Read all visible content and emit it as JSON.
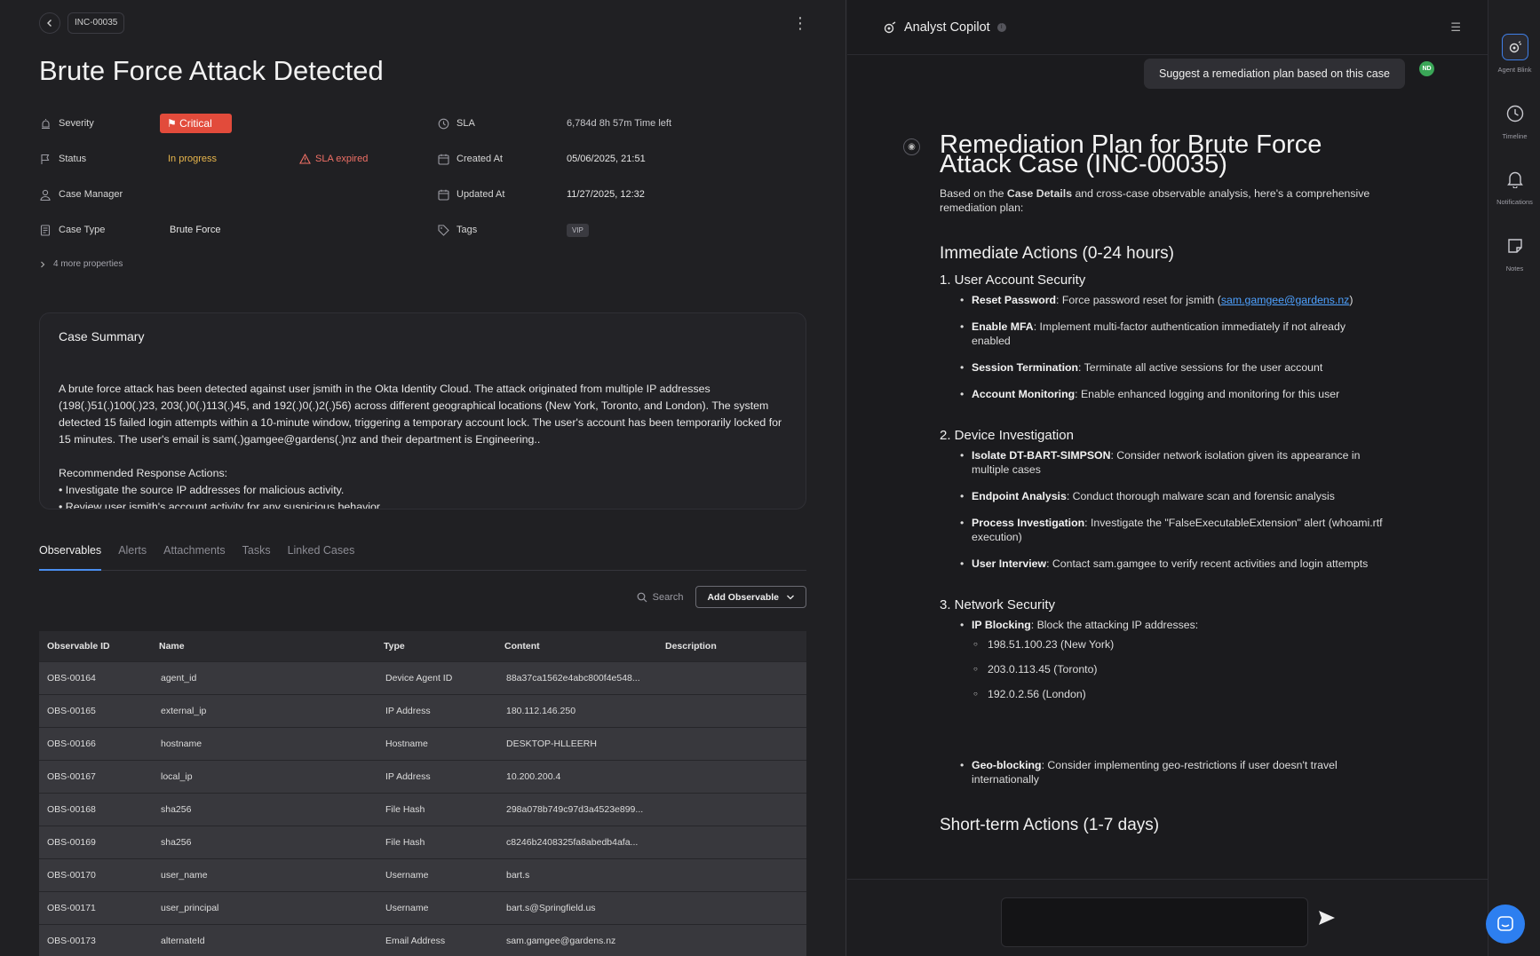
{
  "header": {
    "case_id": "INC-00035",
    "title": "Brute Force Attack Detected"
  },
  "properties": {
    "severity": {
      "label": "Severity",
      "value": "Critical"
    },
    "status": {
      "label": "Status",
      "value": "In progress",
      "sla_flag": "SLA expired"
    },
    "case_manager": {
      "label": "Case Manager",
      "value": ""
    },
    "case_type": {
      "label": "Case Type",
      "value": "Brute Force"
    },
    "sla": {
      "label": "SLA",
      "value": "6,784d 8h 57m  Time left"
    },
    "created": {
      "label": "Created At",
      "value": "05/06/2025, 21:51"
    },
    "updated": {
      "label": "Updated At",
      "value": "11/27/2025, 12:32"
    },
    "tags": {
      "label": "Tags",
      "value": "VIP"
    },
    "more": "4 more properties"
  },
  "summary": {
    "title": "Case Summary",
    "paragraph": "A brute force attack has been detected against user jsmith in the Okta Identity Cloud. The attack originated from multiple IP addresses (198(.)51(.)100(.)23, 203(.)0(.)113(.)45, and 192(.)0(.)2(.)56) across different geographical locations (New York, Toronto, and London). The system detected 15 failed login attempts within a 10-minute window, triggering a temporary account lock. The user's account has been temporarily locked for 15 minutes. The user's email is sam(.)gamgee@gardens(.)nz and their department is Engineering..",
    "actions_title": "Recommended Response Actions:",
    "actions": [
      "• Investigate the source IP addresses for malicious activity.",
      "• Review user jsmith's account activity for any suspicious behavior."
    ]
  },
  "tabs": [
    "Observables",
    "Alerts",
    "Attachments",
    "Tasks",
    "Linked Cases"
  ],
  "toolbar": {
    "search": "Search",
    "add": "Add Observable"
  },
  "table": {
    "headers": [
      "Observable ID",
      "Name",
      "Type",
      "Content",
      "Description"
    ],
    "rows": [
      [
        "OBS-00164",
        "agent_id",
        "Device Agent ID",
        "88a37ca1562e4abc800f4e548...",
        ""
      ],
      [
        "OBS-00165",
        "external_ip",
        "IP Address",
        "180.112.146.250",
        ""
      ],
      [
        "OBS-00166",
        "hostname",
        "Hostname",
        "DESKTOP-HLLEERH",
        ""
      ],
      [
        "OBS-00167",
        "local_ip",
        "IP Address",
        "10.200.200.4",
        ""
      ],
      [
        "OBS-00168",
        "sha256",
        "File Hash",
        "298a078b749c97d3a4523e899...",
        ""
      ],
      [
        "OBS-00169",
        "sha256",
        "File Hash",
        "c8246b2408325fa8abedb4afa...",
        ""
      ],
      [
        "OBS-00170",
        "user_name",
        "Username",
        "bart.s",
        ""
      ],
      [
        "OBS-00171",
        "user_principal",
        "Username",
        "bart.s@Springfield.us",
        ""
      ],
      [
        "OBS-00173",
        "alternateId",
        "Email Address",
        "sam.gamgee@gardens.nz",
        ""
      ]
    ]
  },
  "copilot": {
    "title": "Analyst Copilot",
    "user_message": "Suggest a remediation plan based on this case",
    "user_initials": "ND",
    "answer": {
      "title": "Remediation Plan for Brute Force Attack Case (INC-00035)",
      "intro_pre": "Based on the ",
      "intro_bold": "Case Details",
      "intro_post": " and cross-case observable analysis, here's a comprehensive remediation plan:",
      "immediate": "Immediate Actions (0-24 hours)",
      "s1": "1. User Account Security",
      "s1_items": [
        {
          "b": "Reset Password",
          "t": ": Force password reset for jsmith (",
          "link": "sam.gamgee@gardens.nz",
          "end": ")"
        },
        {
          "b": "Enable MFA",
          "t": ": Implement multi-factor authentication immediately if not already enabled"
        },
        {
          "b": "Session Termination",
          "t": ": Terminate all active sessions for the user account"
        },
        {
          "b": "Account Monitoring",
          "t": ": Enable enhanced logging and monitoring for this user"
        }
      ],
      "s2": "2. Device Investigation",
      "s2_items": [
        {
          "b": "Isolate DT-BART-SIMPSON",
          "t": ": Consider network isolation given its appearance in multiple cases"
        },
        {
          "b": "Endpoint Analysis",
          "t": ": Conduct thorough malware scan and forensic analysis"
        },
        {
          "b": "Process Investigation",
          "t": ": Investigate the \"FalseExecutableExtension\" alert (whoami.rtf execution)"
        },
        {
          "b": "User Interview",
          "t": ": Contact sam.gamgee to verify recent activities and login attempts"
        }
      ],
      "s3": "3. Network Security",
      "ip_blocking_b": "IP Blocking",
      "ip_blocking_t": ": Block the attacking IP addresses:",
      "ips": [
        "198.51.100.23 (New York)",
        "203.0.113.45 (Toronto)",
        "192.0.2.56 (London)"
      ],
      "geo_b": "Geo-blocking",
      "geo_t": ": Consider implementing geo-restrictions if user doesn't travel internationally",
      "short_term": "Short-term Actions (1-7 days)"
    }
  },
  "rail": [
    "Agent Blink",
    "Timeline",
    "Notifications",
    "Notes"
  ]
}
